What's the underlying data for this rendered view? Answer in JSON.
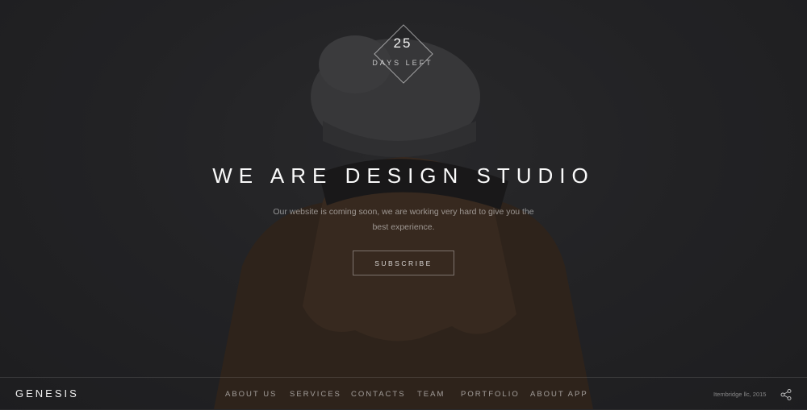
{
  "countdown": {
    "number": "25",
    "label": "DAYS LEFT"
  },
  "hero": {
    "headline": "WE ARE DESIGN STUDIO",
    "subtext": "Our website is coming soon, we are working very hard to give you the best experience.",
    "button_label": "SUBSCRIBE"
  },
  "footer": {
    "brand": "GENESIS",
    "nav": [
      "ABOUT US",
      "SERVICES",
      "CONTACTS",
      "TEAM",
      "PORTFOLIO",
      "ABOUT APP"
    ],
    "copyright": "Itembridge llc, 2015",
    "share_icon": "share-icon"
  },
  "colors": {
    "background": "#2a2a2c",
    "text": "#ffffff",
    "coat": "#4a3524"
  }
}
